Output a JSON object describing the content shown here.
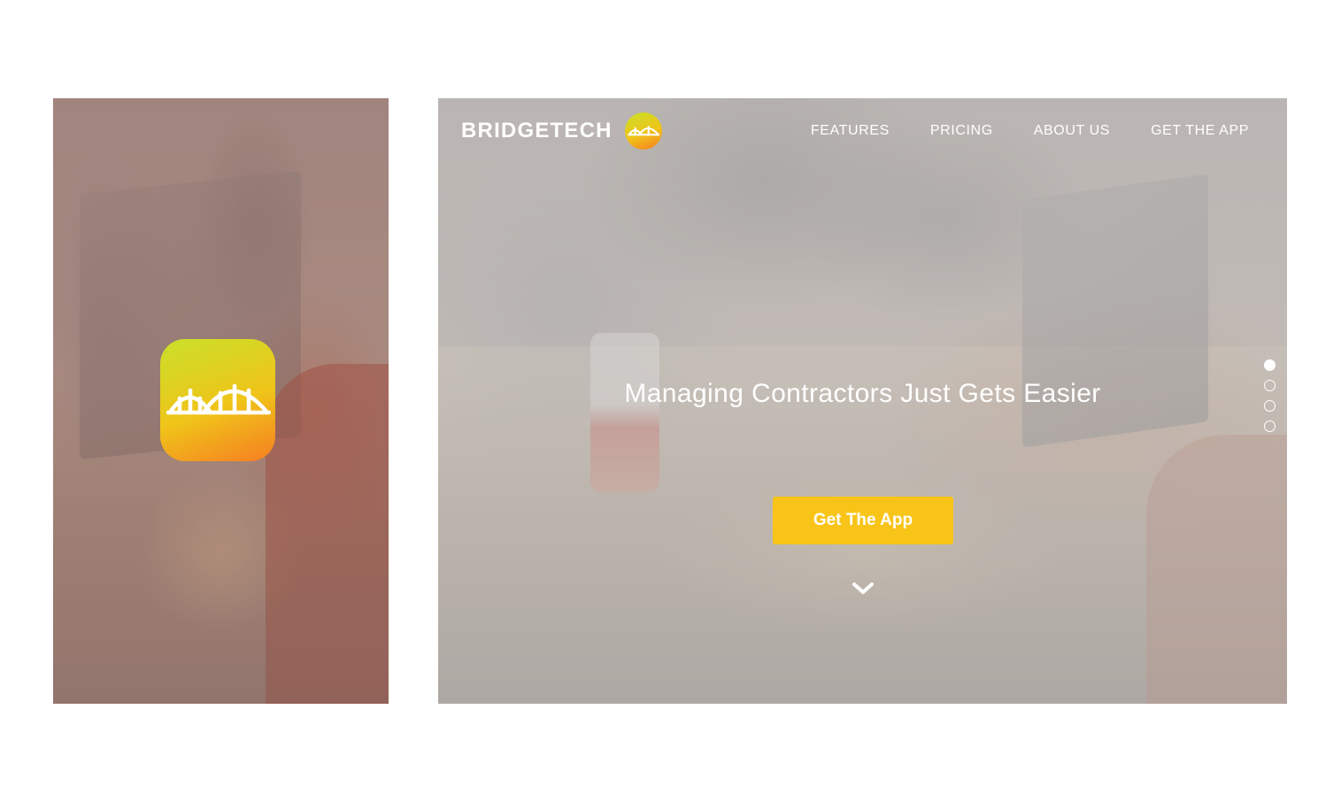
{
  "colors": {
    "accent": "#f9c418",
    "icon_gradient": [
      "#c9e02a",
      "#f0c419",
      "#f57e22"
    ],
    "text": "#ffffff"
  },
  "mobile": {
    "app_icon": "bridge-icon"
  },
  "desktop": {
    "brand": {
      "name": "BRIDGETECH",
      "logo_icon": "bridge-icon"
    },
    "nav": {
      "items": [
        {
          "label": "FEATURES"
        },
        {
          "label": "PRICING"
        },
        {
          "label": "ABOUT US"
        },
        {
          "label": "GET THE APP"
        }
      ]
    },
    "hero": {
      "title": "Managing Contractors Just Gets Easier",
      "cta_label": "Get The App",
      "scroll_icon": "chevron-down-icon"
    },
    "pagination": {
      "count": 4,
      "active_index": 0
    }
  }
}
